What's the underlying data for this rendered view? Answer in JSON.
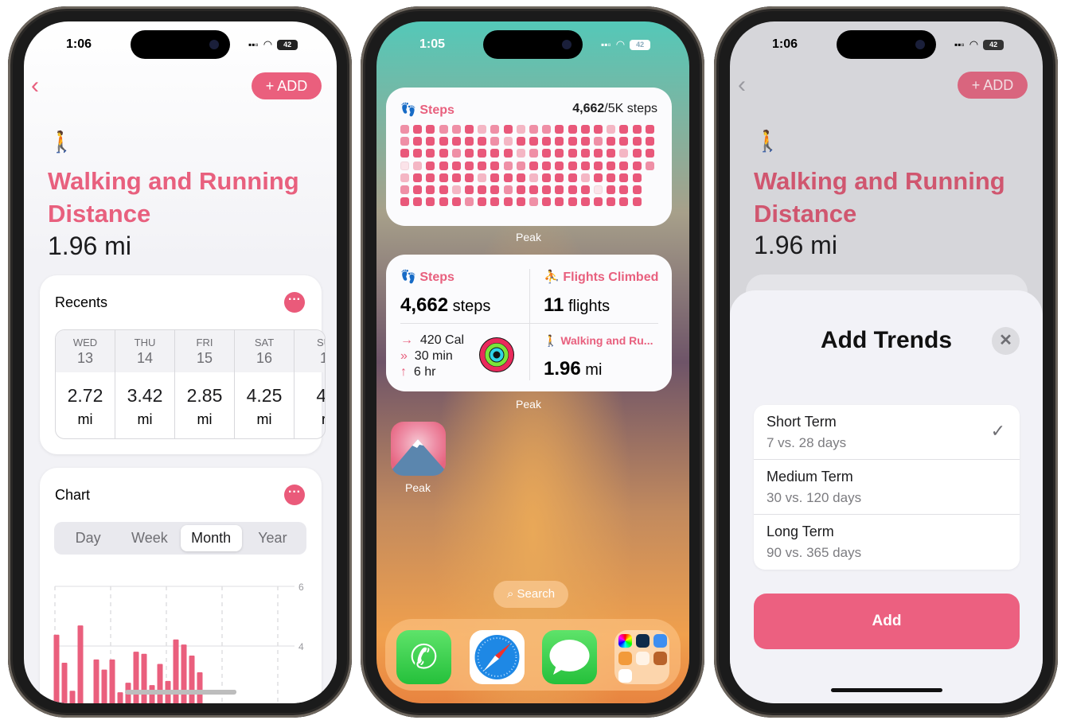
{
  "colors": {
    "accent": "#e8607e",
    "button": "#ea5f7d",
    "sheet_bg": "#f2f2f7"
  },
  "left_phone": {
    "status": {
      "time": "1:06",
      "battery": "42"
    },
    "header": {
      "back_icon": "chevron-left",
      "add_label": "+ ADD"
    },
    "metric": {
      "icon": "figure-walk",
      "title": "Walking and Running Distance",
      "value": "1.96 mi"
    },
    "recents": {
      "title": "Recents",
      "columns": [
        {
          "day": "WED",
          "date": "13",
          "value": "2.72",
          "unit": "mi"
        },
        {
          "day": "THU",
          "date": "14",
          "value": "3.42",
          "unit": "mi"
        },
        {
          "day": "FRI",
          "date": "15",
          "value": "2.85",
          "unit": "mi"
        },
        {
          "day": "SAT",
          "date": "16",
          "value": "4.25",
          "unit": "mi"
        },
        {
          "day": "SU",
          "date": "1",
          "value": "4.",
          "unit": "r"
        }
      ]
    },
    "chart_card": {
      "title": "Chart",
      "segments": [
        "Day",
        "Week",
        "Month",
        "Year"
      ],
      "selected": "Month"
    }
  },
  "chart_data": {
    "type": "bar",
    "values": [
      4.38,
      3.44,
      2.5,
      4.69,
      null,
      3.55,
      3.21,
      3.55,
      2.45,
      2.77,
      3.81,
      3.74,
      2.69,
      3.4,
      2.83,
      4.22,
      4.05,
      3.68,
      3.12
    ],
    "yticks": [
      "6",
      "4"
    ],
    "y_tick_values": [
      6,
      4
    ],
    "grid": true,
    "color": "#ea5f7d"
  },
  "middle_phone": {
    "status": {
      "time": "1:05",
      "battery": "42"
    },
    "steps_widget": {
      "title": "Steps",
      "count": "4,662",
      "goal": "/5K steps",
      "caption": "Peak",
      "levels": [
        [
          2,
          3,
          3,
          2,
          2,
          3,
          1,
          2,
          3,
          1,
          2,
          2,
          3,
          3,
          3,
          3,
          1,
          3,
          3,
          3
        ],
        [
          2,
          3,
          3,
          3,
          3,
          3,
          3,
          2,
          1,
          3,
          3,
          3,
          3,
          3,
          3,
          2,
          3,
          3,
          3,
          3
        ],
        [
          3,
          3,
          3,
          3,
          2,
          3,
          3,
          3,
          3,
          1,
          2,
          3,
          3,
          3,
          3,
          3,
          3,
          1,
          3,
          3
        ],
        [
          0,
          1,
          3,
          3,
          3,
          3,
          3,
          3,
          2,
          2,
          3,
          3,
          3,
          3,
          3,
          3,
          3,
          3,
          3,
          2
        ],
        [
          1,
          3,
          3,
          3,
          3,
          3,
          1,
          3,
          3,
          3,
          1,
          3,
          3,
          3,
          1,
          3,
          3,
          3,
          3
        ],
        [
          2,
          3,
          3,
          3,
          1,
          3,
          3,
          3,
          2,
          3,
          3,
          3,
          3,
          3,
          3,
          0,
          3,
          3,
          3
        ],
        [
          3,
          3,
          3,
          3,
          3,
          2,
          3,
          3,
          3,
          3,
          2,
          3,
          3,
          3,
          3,
          3,
          3,
          3,
          3
        ]
      ]
    },
    "multi_widget": {
      "caption": "Peak",
      "steps": {
        "title": "Steps",
        "value": "4,662",
        "unit": "steps"
      },
      "flights": {
        "title": "Flights Climbed",
        "value": "11",
        "unit": "flights"
      },
      "activity": {
        "move": "420 Cal",
        "exercise": "30 min",
        "stand": "6 hr"
      },
      "walking": {
        "title": "Walking and Ru...",
        "value": "1.96",
        "unit": "mi"
      }
    },
    "app": {
      "label": "Peak"
    },
    "search": {
      "label": "Search"
    },
    "dock": [
      "phone",
      "safari",
      "messages",
      "folder"
    ]
  },
  "right_phone": {
    "status": {
      "time": "1:06",
      "battery": "42"
    },
    "add_label": "+ ADD",
    "title": "Walking and Running Distance",
    "value": "1.96 mi",
    "sheet": {
      "title": "Add Trends",
      "options": [
        {
          "label": "Short Term",
          "detail": "7 vs. 28 days",
          "checked": true
        },
        {
          "label": "Medium Term",
          "detail": "30 vs. 120 days",
          "checked": false
        },
        {
          "label": "Long Term",
          "detail": "90 vs. 365 days",
          "checked": false
        }
      ],
      "add_button": "Add"
    }
  }
}
